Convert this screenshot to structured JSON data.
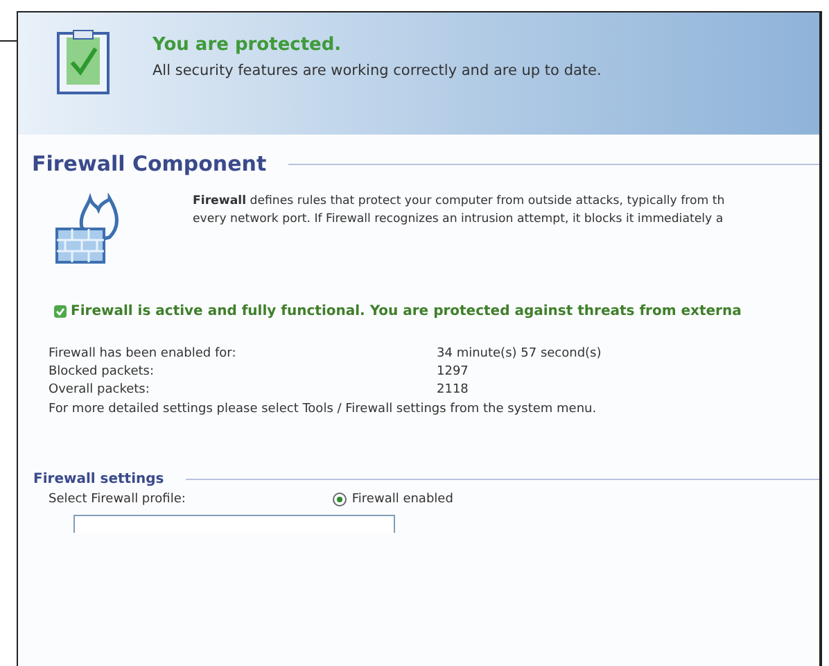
{
  "banner": {
    "title": "You are protected.",
    "message": "All security features are working correctly and are up to date.",
    "protected": true
  },
  "component": {
    "title": "Firewall Component",
    "description_lines": [
      "**Firewall** defines rules that protect your computer from outside attacks, typically from th",
      "every network port. If Firewall recognizes an intrusion attempt, it blocks it immediately a"
    ],
    "status": "Firewall is active and fully functional. You are protected against threats from externa",
    "status_ok": true
  },
  "stats": [
    {
      "label": "Firewall has been enabled for:",
      "value": "34 minute(s) 57 second(s)"
    },
    {
      "label": "Blocked packets:",
      "value": "1297"
    },
    {
      "label": "Overall packets:",
      "value": "2118"
    }
  ],
  "note": "For more detailed settings please select Tools / Firewall settings from the system menu.",
  "settings": {
    "title": "Firewall settings",
    "profile_label": "Select Firewall profile:",
    "options": [
      {
        "label": "Firewall enabled",
        "selected": true
      }
    ]
  }
}
